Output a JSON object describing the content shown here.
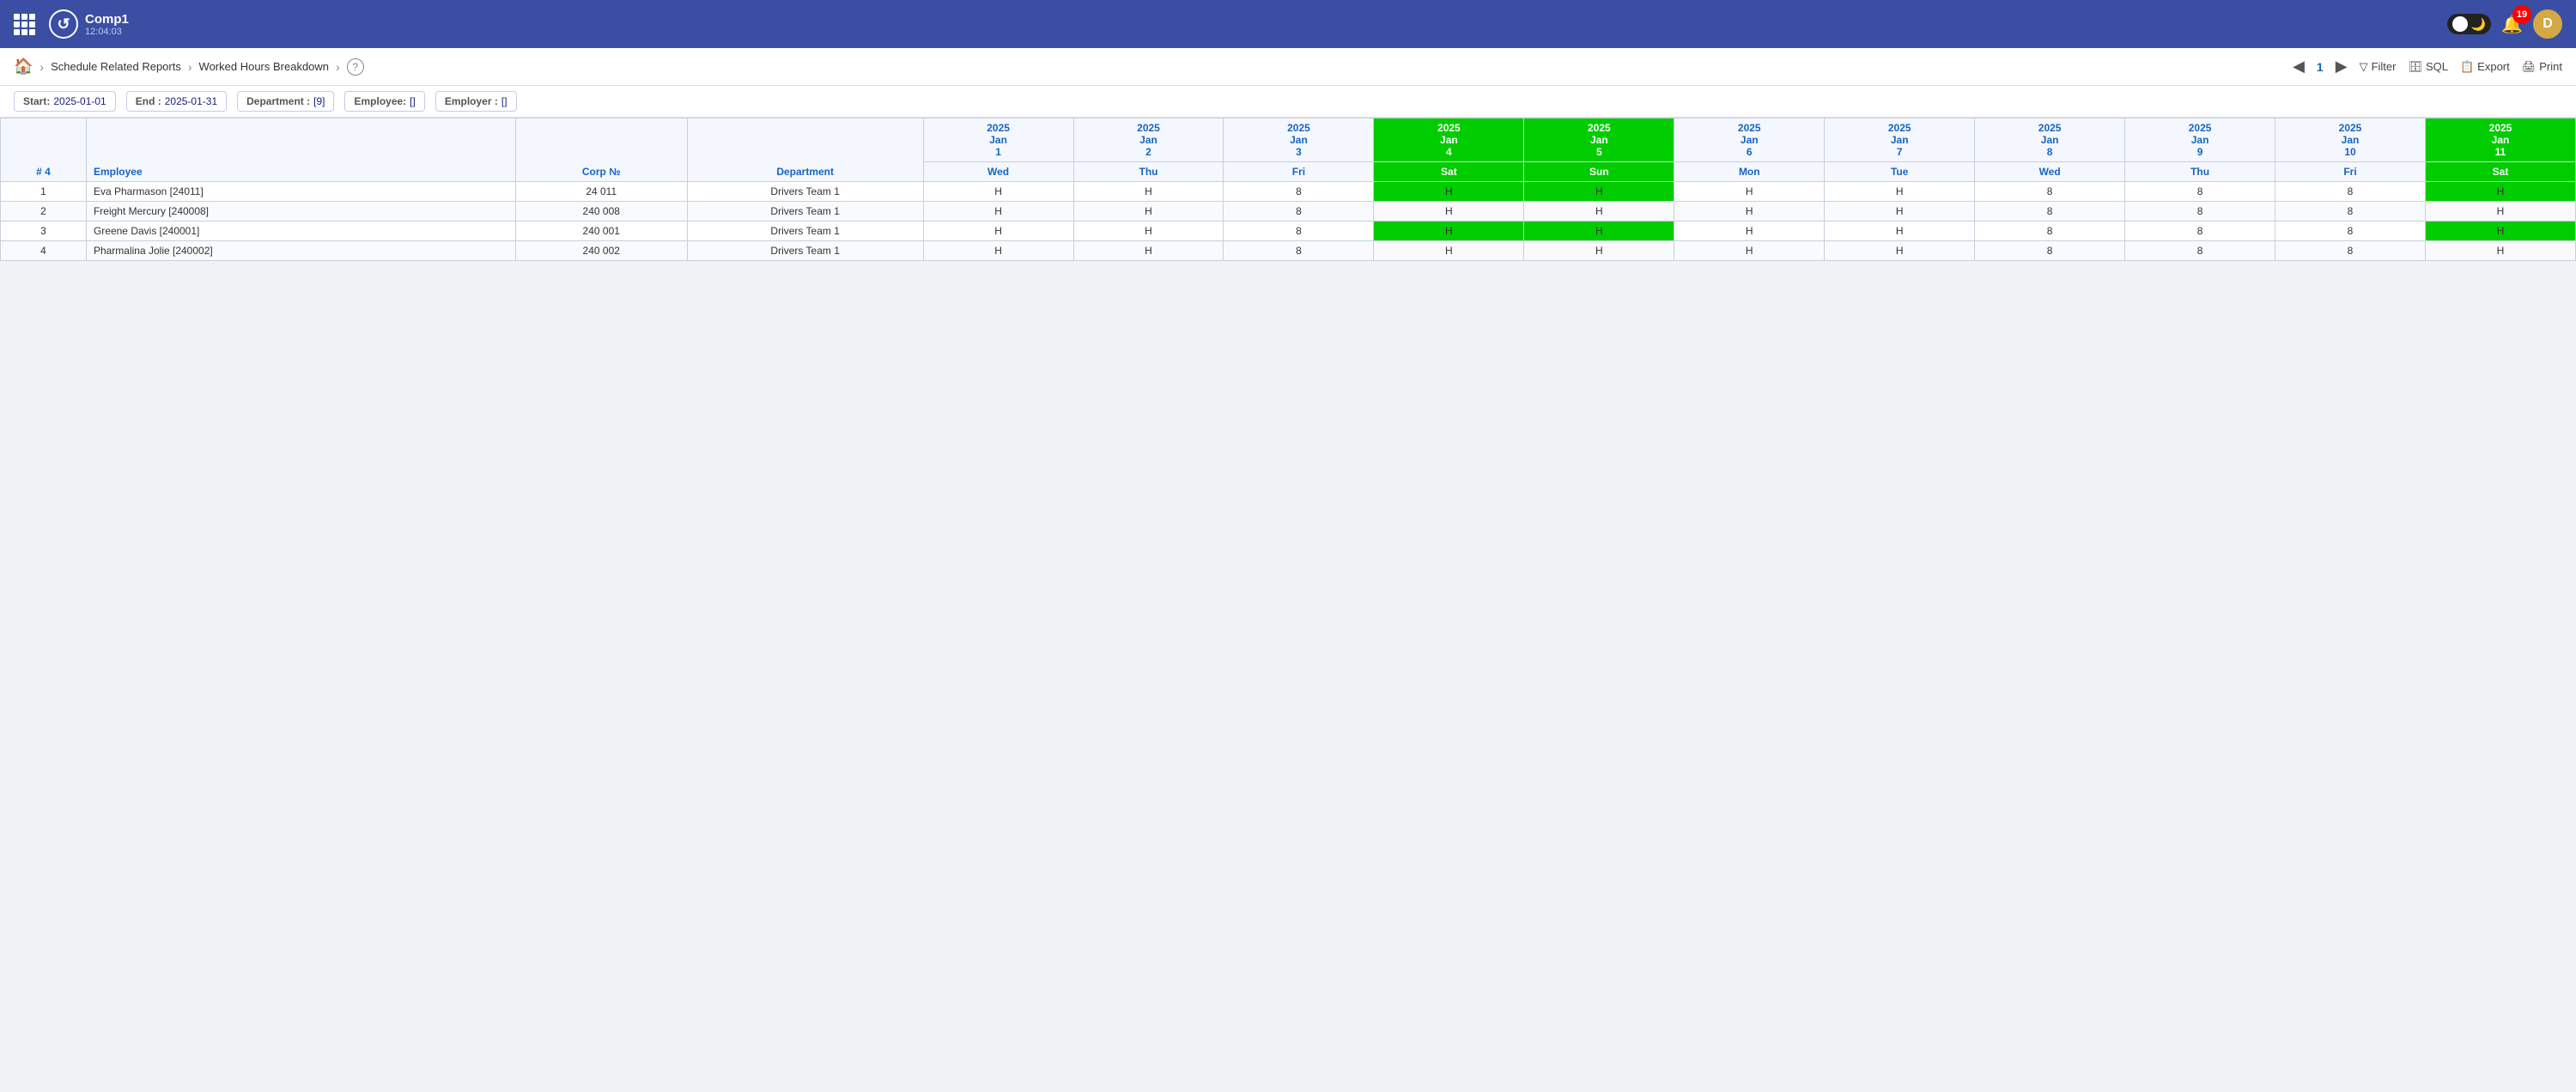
{
  "topbar": {
    "app_name": "Comp1",
    "time": "12:04:03",
    "notification_count": "19",
    "user_initial": "D"
  },
  "breadcrumb": {
    "home_icon": "🏠",
    "items": [
      "Schedule Related Reports",
      "Worked Hours Breakdown"
    ],
    "help_label": "?",
    "page_number": "1",
    "toolbar": {
      "filter_label": "Filter",
      "sql_label": "SQL",
      "export_label": "Export",
      "print_label": "Print"
    }
  },
  "filters": {
    "start_label": "Start:",
    "start_value": "2025-01-01",
    "end_label": "End :",
    "end_value": "2025-01-31",
    "department_label": "Department :",
    "department_value": "[9]",
    "employee_label": "Employee:",
    "employee_value": "[]",
    "employer_label": "Employer :",
    "employer_value": "[]"
  },
  "table": {
    "columns": {
      "num": "# 4",
      "employee": "Employee",
      "corp": "Corp №",
      "department": "Department"
    },
    "date_headers": [
      {
        "year": "2025",
        "month": "Jan",
        "day": "1",
        "weekday": "Wed",
        "is_weekend": false
      },
      {
        "year": "2025",
        "month": "Jan",
        "day": "2",
        "weekday": "Thu",
        "is_weekend": false
      },
      {
        "year": "2025",
        "month": "Jan",
        "day": "3",
        "weekday": "Fri",
        "is_weekend": false
      },
      {
        "year": "2025",
        "month": "Jan",
        "day": "4",
        "weekday": "Sat",
        "is_weekend": true
      },
      {
        "year": "2025",
        "month": "Jan",
        "day": "5",
        "weekday": "Sun",
        "is_weekend": true
      },
      {
        "year": "2025",
        "month": "Jan",
        "day": "6",
        "weekday": "Mon",
        "is_weekend": false
      },
      {
        "year": "2025",
        "month": "Jan",
        "day": "7",
        "weekday": "Tue",
        "is_weekend": false
      },
      {
        "year": "2025",
        "month": "Jan",
        "day": "8",
        "weekday": "Wed",
        "is_weekend": false
      },
      {
        "year": "2025",
        "month": "Jan",
        "day": "9",
        "weekday": "Thu",
        "is_weekend": false
      },
      {
        "year": "2025",
        "month": "Jan",
        "day": "10",
        "weekday": "Fri",
        "is_weekend": false
      },
      {
        "year": "2025",
        "month": "Jan",
        "day": "11",
        "weekday": "Sat",
        "is_weekend": true
      }
    ],
    "rows": [
      {
        "num": "1",
        "employee": "Eva Pharmason [24011]",
        "corp": "24 011",
        "department": "Drivers Team 1",
        "days": [
          "H",
          "H",
          "8",
          "H",
          "H",
          "H",
          "H",
          "8",
          "8",
          "8",
          "H"
        ]
      },
      {
        "num": "2",
        "employee": "Freight Mercury [240008]",
        "corp": "240 008",
        "department": "Drivers Team 1",
        "days": [
          "H",
          "H",
          "8",
          "H",
          "H",
          "H",
          "H",
          "8",
          "8",
          "8",
          "H"
        ]
      },
      {
        "num": "3",
        "employee": "Greene Davis [240001]",
        "corp": "240 001",
        "department": "Drivers Team 1",
        "days": [
          "H",
          "H",
          "8",
          "H",
          "H",
          "H",
          "H",
          "8",
          "8",
          "8",
          "H"
        ]
      },
      {
        "num": "4",
        "employee": "Pharmalina Jolie [240002]",
        "corp": "240 002",
        "department": "Drivers Team 1",
        "days": [
          "H",
          "H",
          "8",
          "H",
          "H",
          "H",
          "H",
          "8",
          "8",
          "8",
          "H"
        ]
      }
    ]
  }
}
